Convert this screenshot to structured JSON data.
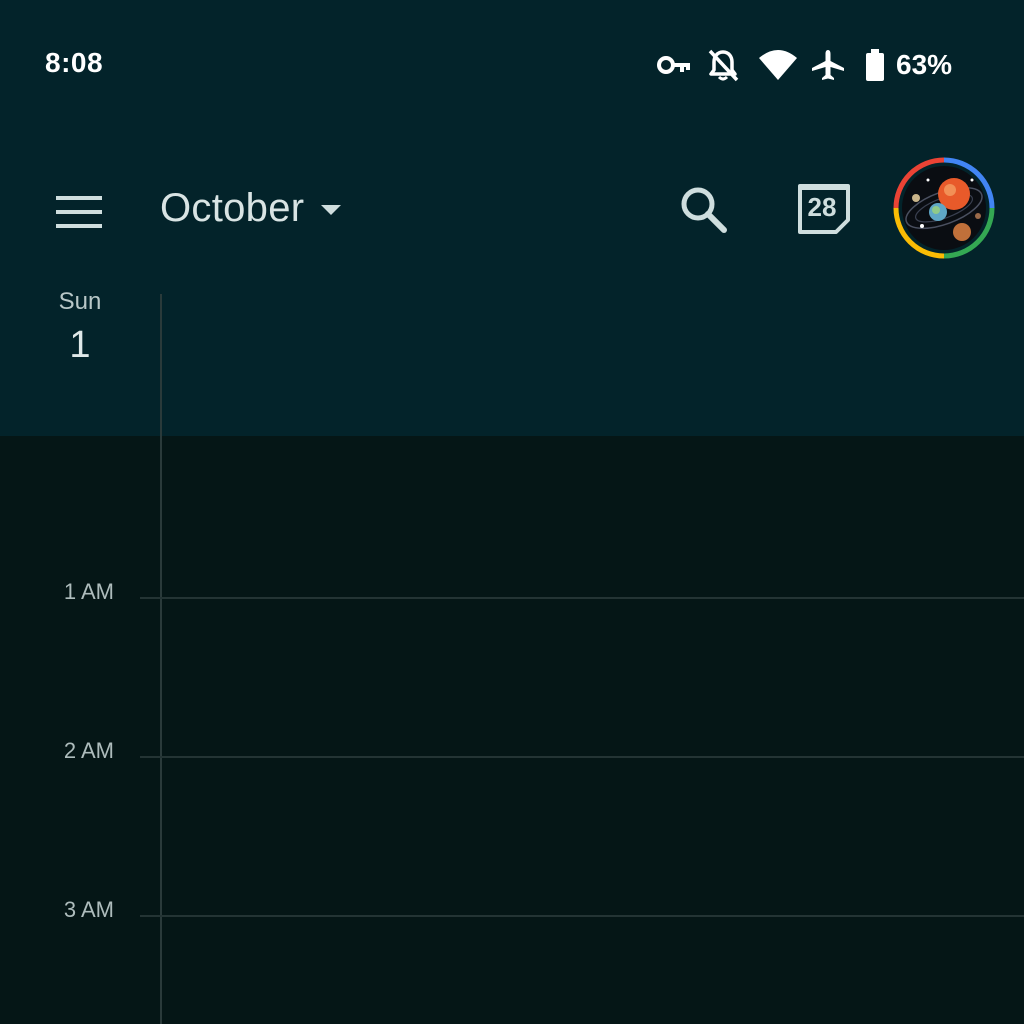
{
  "status_bar": {
    "time": "8:08",
    "icons": [
      "vpn-key-icon",
      "notifications-off-icon",
      "wifi-icon",
      "airplane-mode-icon",
      "battery-icon"
    ],
    "battery_percent": "63%"
  },
  "app_bar": {
    "menu_icon": "hamburger-menu-icon",
    "month_label": "October",
    "dropdown_icon": "caret-down-icon",
    "search_icon": "search-icon",
    "today_icon": "calendar-today-icon",
    "today_date": "28",
    "avatar": "account-avatar"
  },
  "day_header": {
    "day_name": "Sun",
    "day_number": "1"
  },
  "hours": [
    "1 AM",
    "2 AM",
    "3 AM"
  ],
  "colors": {
    "header_bg": "#03232a",
    "grid_bg": "#051616",
    "grid_line": "#243434",
    "text_primary": "#d9e4e4"
  }
}
